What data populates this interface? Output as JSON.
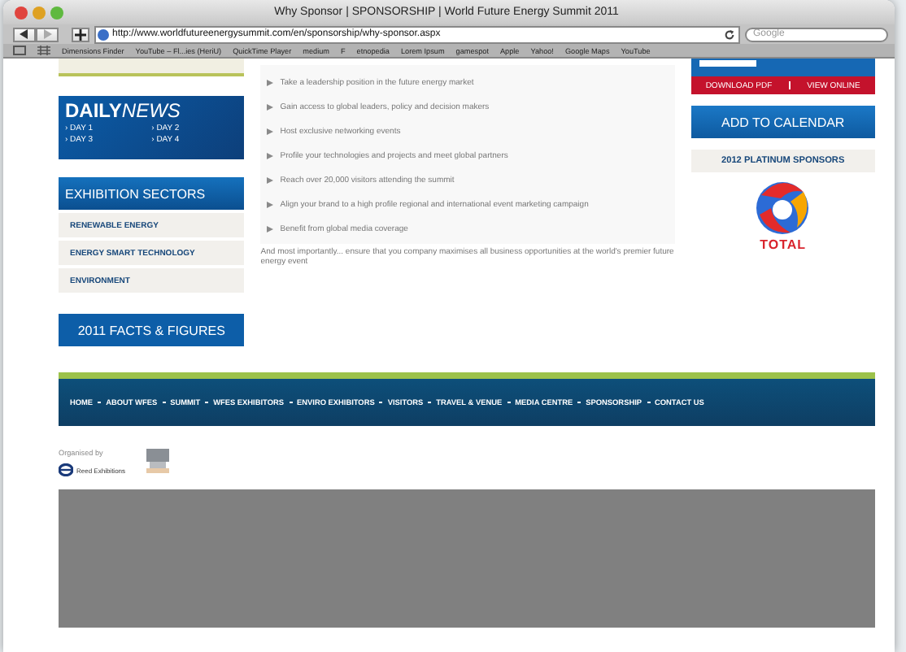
{
  "window": {
    "title": "Why Sponsor | SPONSORSHIP | World Future Energy Summit 2011"
  },
  "toolbar": {
    "url": "http://www.worldfutureenergysummit.com/en/sponsorship/why-sponsor.aspx",
    "search_placeholder": "Google"
  },
  "bookmarks": [
    "Dimensions Finder",
    "YouTube – Fl...ies (HeriU)",
    "QuickTime Player",
    "medium",
    "F",
    "etnopedia",
    "Lorem Ipsum",
    "gamespot",
    "Apple",
    "Yahoo!",
    "Google Maps",
    "YouTube"
  ],
  "left": {
    "daily_news": {
      "title_bold": "DAILY",
      "title_italic": "NEWS",
      "days": [
        "› DAY 1",
        "› DAY 2",
        "› DAY 3",
        "› DAY 4"
      ]
    },
    "sectors": {
      "title": "EXHIBITION SECTORS",
      "items": [
        "RENEWABLE ENERGY",
        "ENERGY SMART TECHNOLOGY",
        "ENVIRONMENT"
      ]
    },
    "facts_button": "2011 FACTS & FIGURES"
  },
  "benefits": [
    "Take a leadership position in the future energy market",
    "Gain access to global leaders, policy and decision makers",
    "Host exclusive networking events",
    "Profile your technologies and projects and meet global partners",
    "Reach over 20,000 visitors attending the summit",
    "Align your brand to a high profile regional and international event marketing campaign",
    "Benefit from global media coverage"
  ],
  "closing": "And most importantly... ensure that you company maximises all business opportunities at the world's premier future energy event",
  "right": {
    "links": [
      "DOWNLOAD PDF",
      "VIEW ONLINE"
    ],
    "calendar_button": "ADD TO CALENDAR",
    "sponsors_title": "2012 PLATINUM SPONSORS",
    "sponsor_name": "TOTAL"
  },
  "footer": {
    "nav": [
      "HOME",
      "ABOUT WFES",
      "SUMMIT",
      "WFES EXHIBITORS",
      "ENVIRO EXHIBITORS",
      "VISITORS",
      "TRAVEL & VENUE",
      "MEDIA CENTRE",
      "SPONSORSHIP",
      "CONTACT US"
    ],
    "organised_by": "Organised by",
    "organiser": "Reed Exhibitions"
  }
}
